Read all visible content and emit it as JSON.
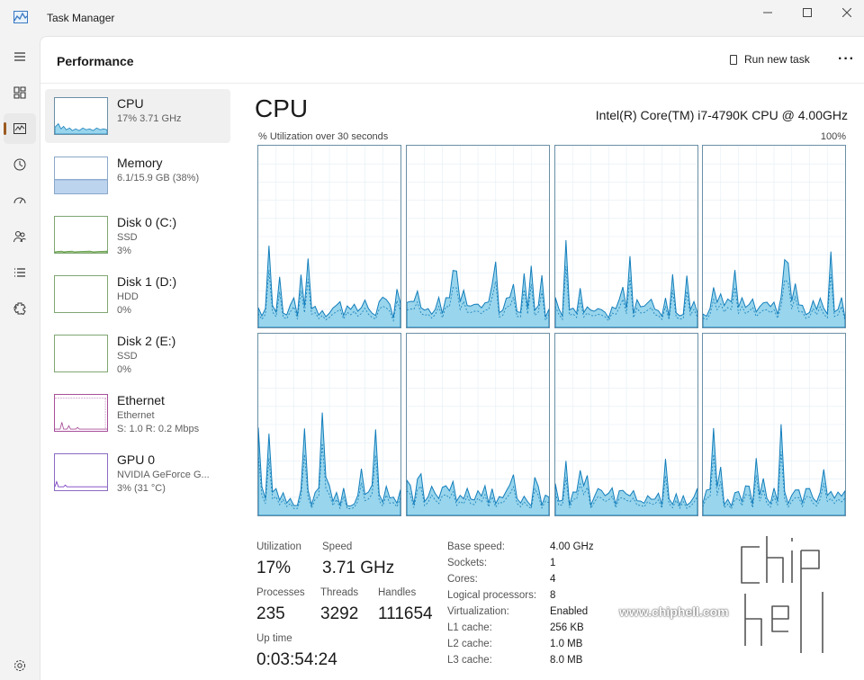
{
  "window": {
    "title": "Task Manager"
  },
  "header": {
    "title": "Performance",
    "run_new_task": "Run new task"
  },
  "rail": [
    "menu-icon",
    "processes-icon",
    "performance-icon",
    "app-history-icon",
    "startup-icon",
    "users-icon",
    "details-icon",
    "services-icon",
    "settings-icon"
  ],
  "resources": [
    {
      "name": "CPU",
      "sub1": "17% 3.71 GHz",
      "sub2": "",
      "sub3": ""
    },
    {
      "name": "Memory",
      "sub1": "6.1/15.9 GB (38%)",
      "sub2": "",
      "sub3": ""
    },
    {
      "name": "Disk 0 (C:)",
      "sub1": "SSD",
      "sub2": "3%",
      "sub3": ""
    },
    {
      "name": "Disk 1 (D:)",
      "sub1": "HDD",
      "sub2": "0%",
      "sub3": ""
    },
    {
      "name": "Disk 2 (E:)",
      "sub1": "SSD",
      "sub2": "0%",
      "sub3": ""
    },
    {
      "name": "Ethernet",
      "sub1": "Ethernet",
      "sub2": "S: 1.0 R: 0.2 Mbps",
      "sub3": ""
    },
    {
      "name": "GPU 0",
      "sub1": "NVIDIA GeForce G...",
      "sub2": "3% (31 °C)",
      "sub3": ""
    }
  ],
  "cpu": {
    "title": "CPU",
    "model": "Intel(R) Core(TM) i7-4790K CPU @ 4.00GHz",
    "util_label": "% Utilization over 30 seconds",
    "util_max": "100%",
    "stats": {
      "utilization_label": "Utilization",
      "utilization": "17%",
      "speed_label": "Speed",
      "speed": "3.71 GHz",
      "processes_label": "Processes",
      "processes": "235",
      "threads_label": "Threads",
      "threads": "3292",
      "handles_label": "Handles",
      "handles": "111654",
      "uptime_label": "Up time",
      "uptime": "0:03:54:24"
    },
    "details": [
      {
        "k": "Base speed:",
        "v": "4.00 GHz"
      },
      {
        "k": "Sockets:",
        "v": "1"
      },
      {
        "k": "Cores:",
        "v": "4"
      },
      {
        "k": "Logical processors:",
        "v": "8"
      },
      {
        "k": "Virtualization:",
        "v": "Enabled"
      },
      {
        "k": "L1 cache:",
        "v": "256 KB"
      },
      {
        "k": "L2 cache:",
        "v": "1.0 MB"
      },
      {
        "k": "L3 cache:",
        "v": "8.0 MB"
      }
    ]
  },
  "watermark": {
    "url": "www.chiphell.com",
    "logo": "chip hell"
  },
  "colors": {
    "cpu_line": "#117dbb",
    "cpu_fill": "#99d5ec",
    "memory_line": "#8aa7c9",
    "memory_fill": "#bcd4ee",
    "ethernet_line": "#a74f9a",
    "gpu_line": "#7a3fc1",
    "grid": "#e3eef4"
  }
}
